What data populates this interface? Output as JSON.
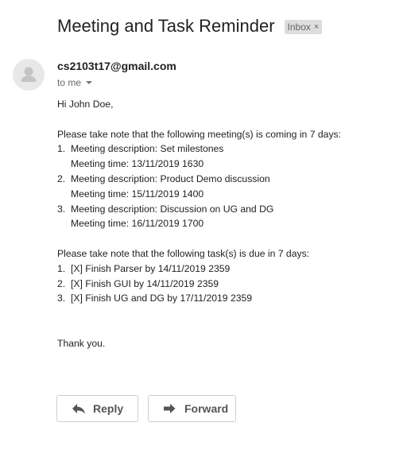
{
  "header": {
    "subject": "Meeting and Task Reminder",
    "label": "Inbox",
    "label_close": "×"
  },
  "message": {
    "sender": "cs2103t17@gmail.com",
    "recipient": "to me",
    "greeting": "Hi John Doe,",
    "meetings_intro": "Please take note that the following meeting(s) is coming in 7 days:",
    "meetings": [
      {
        "num": "1.",
        "description": "Meeting description: Set milestones",
        "time": "Meeting time: 13/11/2019 1630"
      },
      {
        "num": "2.",
        "description": "Meeting description: Product Demo discussion",
        "time": "Meeting time: 15/11/2019 1400"
      },
      {
        "num": "3.",
        "description": "Meeting description: Discussion on UG and DG",
        "time": "Meeting time: 16/11/2019 1700"
      }
    ],
    "tasks_intro": "Please take note that the following task(s) is due in 7 days:",
    "tasks": [
      {
        "num": "1.",
        "text": "[X] Finish Parser by 14/11/2019 2359"
      },
      {
        "num": "2.",
        "text": "[X] Finish GUI by 14/11/2019 2359"
      },
      {
        "num": "3.",
        "text": "[X] Finish UG and DG by 17/11/2019 2359"
      }
    ],
    "closing": "Thank you."
  },
  "actions": {
    "reply_label": "Reply",
    "forward_label": "Forward"
  },
  "icons": {
    "avatar": "person-icon",
    "reply": "reply-arrow-icon",
    "forward": "forward-arrow-icon",
    "caret": "caret-down-icon"
  },
  "colors": {
    "text": "#222222",
    "muted": "#666666",
    "label_bg": "#dddddd",
    "avatar_bg": "#e8e8e8",
    "button_border": "#cfcfcf"
  }
}
